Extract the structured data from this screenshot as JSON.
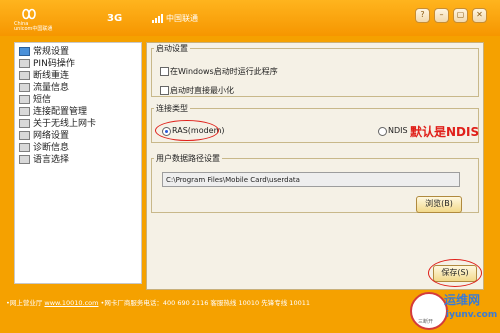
{
  "titlebar": {
    "logo_text": "China\nunicom中国联通",
    "network": "3G",
    "carrier": "中国联通",
    "controls": [
      "?",
      "–",
      "▢",
      "✕"
    ]
  },
  "sidebar": {
    "items": [
      {
        "label": "常规设置",
        "active": true
      },
      {
        "label": "PIN码操作"
      },
      {
        "label": "断线重连"
      },
      {
        "label": "流量信息"
      },
      {
        "label": "短信"
      },
      {
        "label": "连接配置管理"
      },
      {
        "label": "关于无线上网卡"
      },
      {
        "label": "网络设置"
      },
      {
        "label": "诊断信息"
      },
      {
        "label": "语言选择"
      }
    ]
  },
  "startup": {
    "legend": "启动设置",
    "run_on_start_label": "在Windows启动时运行此程序",
    "minimize_label": "启动时直接最小化"
  },
  "connection": {
    "legend": "连接类型",
    "ras_label": "RAS(modem)",
    "ndis_label": "NDIS",
    "annotation": "默认是NDIS",
    "selected": "RAS(modem)"
  },
  "userdata": {
    "legend": "用户数据路径设置",
    "path_value": "C:\\Program Files\\Mobile Card\\userdata",
    "browse_label": "浏览(B)"
  },
  "save_label": "保存(S)",
  "footer": {
    "prefix": "•网上营业厅",
    "link": "www.10010.com",
    "rest": " •网卡厂商服务电话：400 690 2116   客服热线 10010  先锋专线 10011"
  },
  "watermark": {
    "title": "运维网",
    "site": "iyunv.com",
    "badge": "三断开"
  },
  "colors": {
    "accent": "#f5a100",
    "panel": "#f5f1e6",
    "annotation": "#e0201a"
  }
}
